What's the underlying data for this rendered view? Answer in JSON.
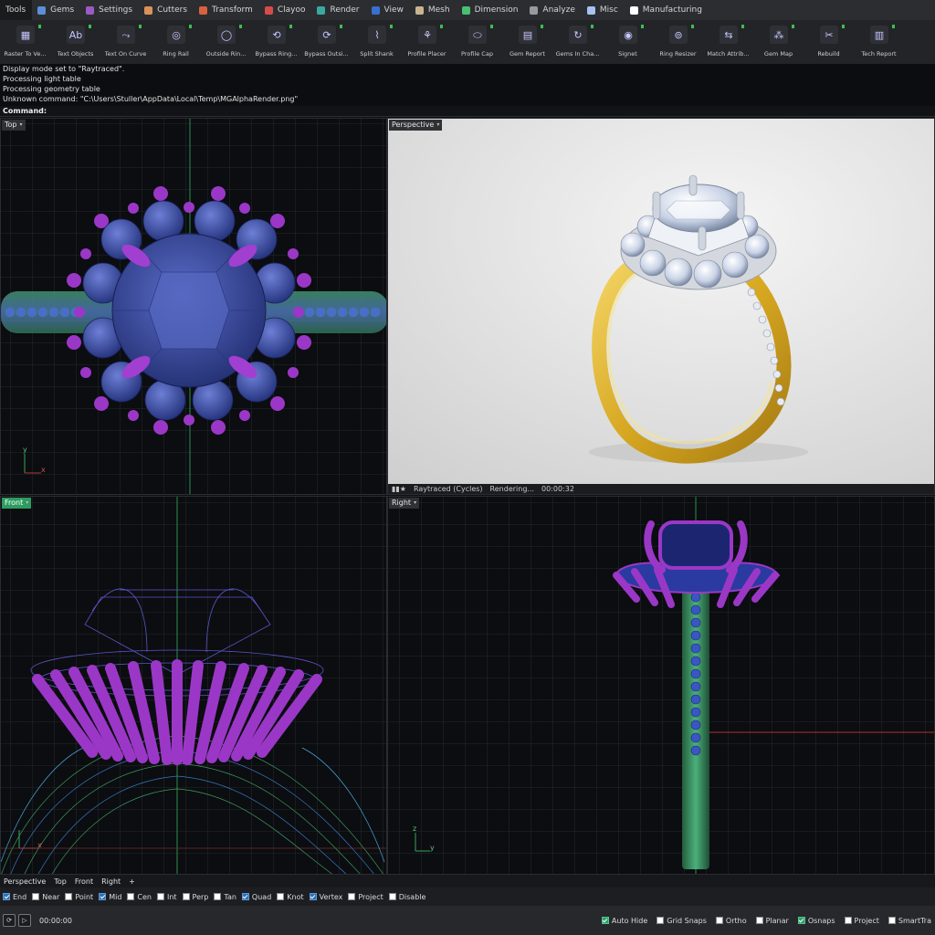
{
  "tabs": [
    {
      "label": "Tools",
      "color": "",
      "active": true
    },
    {
      "label": "Gems",
      "color": "#5b8fd6"
    },
    {
      "label": "Settings",
      "color": "#9c5bc4"
    },
    {
      "label": "Cutters",
      "color": "#d9935a"
    },
    {
      "label": "Transform",
      "color": "#d9603f"
    },
    {
      "label": "Clayoo",
      "color": "#d64b4b"
    },
    {
      "label": "Render",
      "color": "#3aa9a2"
    },
    {
      "label": "View",
      "color": "#3a6fcf"
    },
    {
      "label": "Mesh",
      "color": "#c9b48f"
    },
    {
      "label": "Dimension",
      "color": "#4bbf73"
    },
    {
      "label": "Analyze",
      "color": "#9a9a9a"
    },
    {
      "label": "Misc",
      "color": "#a7c2ef"
    },
    {
      "label": "Manufacturing",
      "color": "#ffffff"
    }
  ],
  "toolbar": [
    {
      "label": "Raster To Ve...",
      "icon": "raster-icon"
    },
    {
      "label": "Text Objects",
      "icon": "text-objects-icon"
    },
    {
      "label": "Text On Curve",
      "icon": "text-curve-icon"
    },
    {
      "label": "Ring Rail",
      "icon": "ring-rail-icon"
    },
    {
      "label": "Outside Rin...",
      "icon": "outside-ring-icon"
    },
    {
      "label": "Bypass Ring...",
      "icon": "bypass-ring-icon"
    },
    {
      "label": "Bypass Outsi...",
      "icon": "bypass-outside-icon"
    },
    {
      "label": "Split Shank",
      "icon": "split-shank-icon"
    },
    {
      "label": "Profile Placer",
      "icon": "profile-placer-icon"
    },
    {
      "label": "Profile Cap",
      "icon": "profile-cap-icon"
    },
    {
      "label": "Gem Report",
      "icon": "gem-report-icon"
    },
    {
      "label": "Gems In Cha...",
      "icon": "gems-channel-icon"
    },
    {
      "label": "Signet",
      "icon": "signet-icon"
    },
    {
      "label": "Ring Resizer",
      "icon": "ring-resizer-icon"
    },
    {
      "label": "Match Attrib...",
      "icon": "match-attrib-icon"
    },
    {
      "label": "Gem Map",
      "icon": "gem-map-icon"
    },
    {
      "label": "Rebuild",
      "icon": "rebuild-icon"
    },
    {
      "label": "Tech Report",
      "icon": "tech-report-icon"
    }
  ],
  "log": [
    "Display mode set to \"Raytraced\".",
    "Processing light table",
    "Processing geometry table",
    "Unknown command: \"C:\\Users\\Stuller\\AppData\\Local\\Temp\\MGAlphaRender.png\""
  ],
  "command_label": "Command:",
  "viewports": {
    "top": {
      "label": "Top"
    },
    "perspective": {
      "label": "Perspective",
      "status": "Raytraced (Cycles)",
      "state": "Rendering...",
      "time": "00:00:32"
    },
    "front": {
      "label": "Front"
    },
    "right": {
      "label": "Right"
    }
  },
  "viewport_tabs": [
    "Perspective",
    "Top",
    "Front",
    "Right"
  ],
  "add_viewport": "+",
  "osnaps": [
    {
      "label": "End",
      "checked": true
    },
    {
      "label": "Near",
      "checked": false
    },
    {
      "label": "Point",
      "checked": false
    },
    {
      "label": "Mid",
      "checked": true
    },
    {
      "label": "Cen",
      "checked": false
    },
    {
      "label": "Int",
      "checked": false
    },
    {
      "label": "Perp",
      "checked": false
    },
    {
      "label": "Tan",
      "checked": false
    },
    {
      "label": "Quad",
      "checked": true
    },
    {
      "label": "Knot",
      "checked": false
    },
    {
      "label": "Vertex",
      "checked": true
    },
    {
      "label": "Project",
      "checked": false
    },
    {
      "label": "Disable",
      "checked": false
    }
  ],
  "status": {
    "time": "00:00:00",
    "toggles": [
      {
        "label": "Auto Hide",
        "checked": true
      },
      {
        "label": "Grid Snaps",
        "checked": false
      },
      {
        "label": "Ortho",
        "checked": false
      },
      {
        "label": "Planar",
        "checked": false
      },
      {
        "label": "Osnaps",
        "checked": true
      },
      {
        "label": "Project",
        "checked": false
      },
      {
        "label": "SmartTra",
        "checked": false
      }
    ]
  }
}
